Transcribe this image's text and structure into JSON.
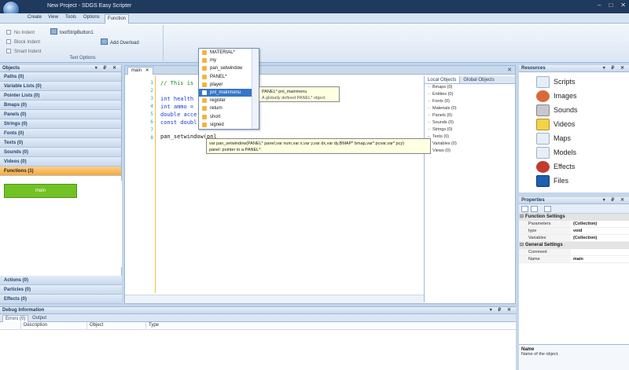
{
  "window": {
    "title": "New Project - SDGS Easy Scripter",
    "controls": [
      "–",
      "□",
      "✕"
    ]
  },
  "menu": [
    "Create",
    "View",
    "Tools",
    "Options",
    "Function"
  ],
  "ribbon": {
    "checkboxes": [
      "No Indent",
      "Block Indent",
      "Smart Indent"
    ],
    "button1": "toolStripButton1",
    "button2": "Add Overload",
    "group_label": "Text Options"
  },
  "objects_panel": {
    "title": "Objects",
    "header_buttons": "▾ ₽ ✕",
    "items": [
      "Paths (0)",
      "Variable Lists (0)",
      "Pointer Lists (0)",
      "Bmaps (0)",
      "Panels (0)",
      "Strings (0)",
      "Fonts (0)",
      "Texts (0)",
      "Sounds (0)",
      "Videos (0)",
      "Functions (1)"
    ],
    "selected_item": "Functions (1)",
    "function_block": "main",
    "bottom_items": [
      "Actions (0)",
      "Particles (0)",
      "Effects (0)"
    ]
  },
  "editor": {
    "tab_label": "main",
    "tab_close": "✕",
    "line_numbers": [
      "1",
      "2",
      "3",
      "4",
      "5",
      "6",
      "7",
      "8"
    ],
    "lines": [
      {
        "text": "// This is",
        "type": "comment"
      },
      {
        "text": "",
        "type": "blank"
      },
      {
        "text": "int health",
        "type": "code"
      },
      {
        "text": "int ammo =",
        "type": "code"
      },
      {
        "text": "double acce",
        "type": "code"
      },
      {
        "text": "const doubl",
        "type": "code"
      },
      {
        "text": "",
        "type": "blank"
      },
      {
        "text": "pan_setwindow(pnl",
        "type": "code"
      }
    ],
    "local_tabs": [
      "Local Objects",
      "Global Objects"
    ],
    "local_items": [
      "Bmaps (0)",
      "Entities (0)",
      "Fonts (0)",
      "Materials (0)",
      "Panels (0)",
      "Sounds (0)",
      "Strings (0)",
      "Texts (0)",
      "Variables (0)",
      "Views (0)"
    ]
  },
  "autocomplete": {
    "items": [
      "MATERIAL*",
      "my",
      "pan_setwindow",
      "PANEL*",
      "player",
      "pnl_mainmenu",
      "register",
      "return",
      "short",
      "signed"
    ],
    "selected": "pnl_mainmenu",
    "tooltip_title": "PANEL* pnl_mainmenu",
    "tooltip_text": "A globally defined PANEL* object",
    "signature": "var pan_setwindow(PANEL* panel,var num,var x,var y,var dx,var dy,BMAP* bmap,var* pcvar,var* pcy)",
    "signature_desc": "panel: pointer to a PANEL*."
  },
  "resources": {
    "title": "Resources",
    "header_buttons": "▾ ₽ ✕",
    "items": [
      {
        "label": "Scripts",
        "icon": "scripts-icon",
        "color": "#e7eef8"
      },
      {
        "label": "Images",
        "icon": "images-icon",
        "color": "#d86a3a"
      },
      {
        "label": "Sounds",
        "icon": "sounds-icon",
        "color": "#c7c8cf"
      },
      {
        "label": "Videos",
        "icon": "videos-icon",
        "color": "#f3d24a"
      },
      {
        "label": "Maps",
        "icon": "maps-icon",
        "color": "#e7eef8"
      },
      {
        "label": "Models",
        "icon": "models-icon",
        "color": "#e7eef8"
      },
      {
        "label": "Effects",
        "icon": "effects-icon",
        "color": "#c23b2c"
      },
      {
        "label": "Files",
        "icon": "files-icon",
        "color": "#1d5fb0"
      }
    ]
  },
  "properties": {
    "title": "Properties",
    "header_buttons": "▾ ₽ ✕",
    "categories": [
      {
        "name": "Function Settings",
        "rows": [
          {
            "key": "Parameters",
            "value": "(Collection)"
          },
          {
            "key": "type",
            "value": "void"
          },
          {
            "key": "Variables",
            "value": "(Collection)"
          }
        ]
      },
      {
        "name": "General Settings",
        "rows": [
          {
            "key": "Comment",
            "value": ""
          },
          {
            "key": "Name",
            "value": "main"
          }
        ]
      }
    ],
    "desc_title": "Name",
    "desc_text": "Name of the object."
  },
  "debug": {
    "title": "Debug Information",
    "header_buttons": "▾ ₽ ✕",
    "tabs": [
      "Errors (0)",
      "Output"
    ],
    "columns": [
      "Description",
      "Object",
      "Type"
    ]
  }
}
